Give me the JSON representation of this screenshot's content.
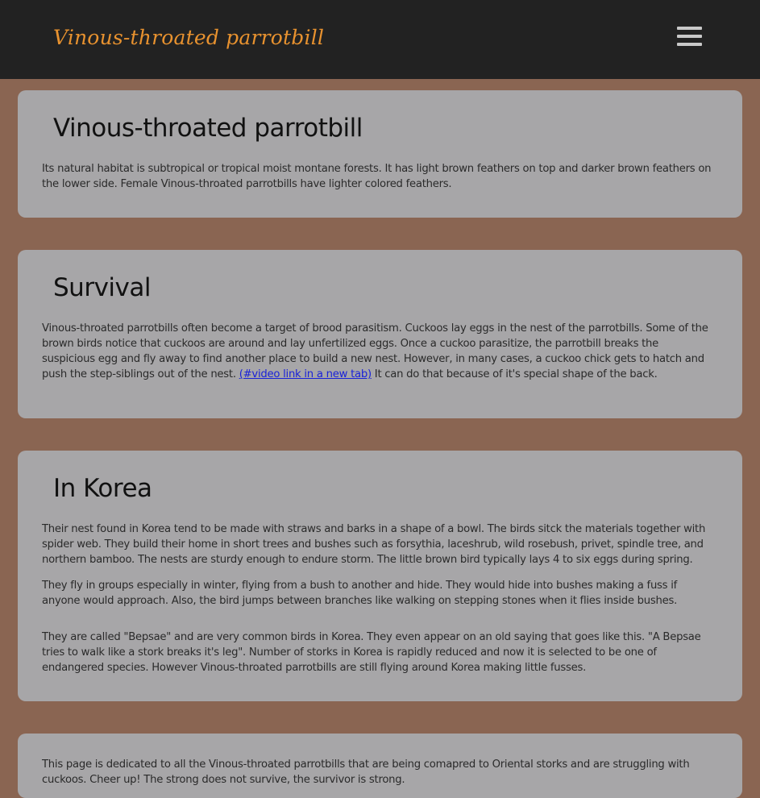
{
  "header": {
    "site_title": "Vinous-throated parrotbill",
    "menu_icon": "hamburger-menu-icon"
  },
  "sections": [
    {
      "heading": "Vinous-throated parrotbill",
      "paragraphs": [
        "Its natural habitat is subtropical or tropical moist montane forests. It has light brown feathers on top and darker brown feathers on the lower side. Female Vinous-throated parrotbills have lighter colored feathers."
      ]
    },
    {
      "heading": "Survival",
      "paragraph_before_link": "Vinous-throated parrotbills often become a target of brood parasitism. Cuckoos lay eggs in the nest of the parrotbills. Some of the brown birds notice that cuckoos are around and lay unfertilized eggs. Once a cuckoo parasitize, the parrotbill breaks the suspicious egg and fly away to find another place to build a new nest. However, in many cases, a cuckoo chick gets to hatch and push the step-siblings out of the nest. ",
      "link_text": "(#video link in a new tab)",
      "paragraph_after_link": " It can do that because of it's special shape of the back."
    },
    {
      "heading": "In Korea",
      "paragraphs": [
        "Their nest found in Korea tend to be made with straws and barks in a shape of a bowl. The birds sitck the materials together with spider web. They build their home in short trees and bushes such as forsythia, laceshrub, wild rosebush, privet, spindle tree, and northern bamboo. The nests are sturdy enough to endure storm. The little brown bird typically lays 4 to six eggs during spring.",
        "They fly in groups especially in winter, flying from a bush to another and hide. They would hide into bushes making a fuss if anyone would approach. Also, the bird jumps between branches like walking on stepping stones when it flies inside bushes.",
        "They are called \"Bepsae\" and are very common birds in Korea. They even appear on an old saying that goes like this. \"A Bepsae tries to walk like a stork breaks it's leg\". Number of storks in Korea is rapidly reduced and now it is selected to be one of endangered species. However Vinous-throated parrotbills are still flying around Korea making little fusses."
      ]
    },
    {
      "paragraphs": [
        "This page is dedicated to all the Vinous-throated parrotbills that are being comapred to Oriental storks and are struggling with cuckoos. Cheer up! The strong does not survive, the survivor is strong."
      ]
    }
  ],
  "colors": {
    "background": "#8a6552",
    "header_bg": "#222222",
    "title_accent": "#e8922f",
    "card_bg": "#a7a6a8",
    "link": "#1a22d8"
  }
}
